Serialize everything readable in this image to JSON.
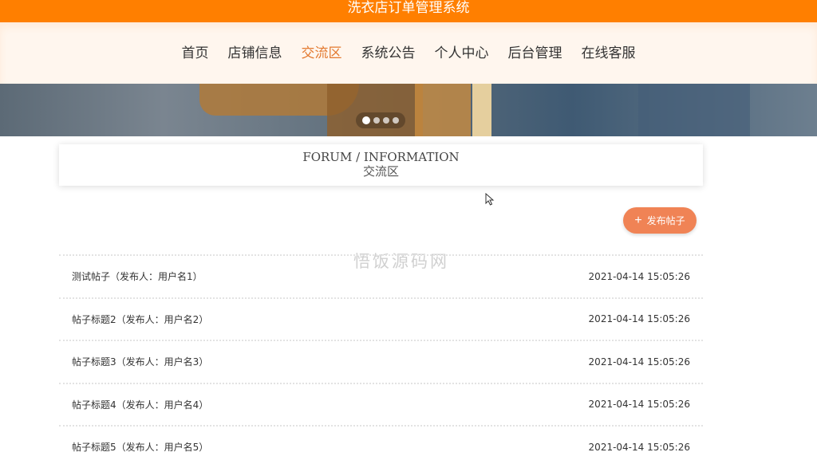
{
  "header": {
    "title": "洗衣店订单管理系统",
    "brand_color": "#ff7f00"
  },
  "nav": {
    "items": [
      {
        "label": "首页"
      },
      {
        "label": "店铺信息"
      },
      {
        "label": "交流区",
        "active": true
      },
      {
        "label": "系统公告"
      },
      {
        "label": "个人中心"
      },
      {
        "label": "后台管理"
      },
      {
        "label": "在线客服"
      }
    ],
    "active_color": "#e3792f"
  },
  "carousel": {
    "slide_count": 4,
    "active_index": 0
  },
  "section": {
    "title_en": "FORUM / INFORMATION",
    "title_cn": "交流区"
  },
  "publish_button": {
    "label": "发布帖子",
    "icon": "plus-icon",
    "color": "#f08355"
  },
  "watermark": "悟饭源码网",
  "posts": [
    {
      "title": "测试帖子（发布人：用户名1）",
      "time": "2021-04-14 15:05:26"
    },
    {
      "title": "帖子标题2（发布人：用户名2）",
      "time": "2021-04-14 15:05:26"
    },
    {
      "title": "帖子标题3（发布人：用户名3）",
      "time": "2021-04-14 15:05:26"
    },
    {
      "title": "帖子标题4（发布人：用户名4）",
      "time": "2021-04-14 15:05:26"
    },
    {
      "title": "帖子标题5（发布人：用户名5）",
      "time": "2021-04-14 15:05:26"
    }
  ]
}
